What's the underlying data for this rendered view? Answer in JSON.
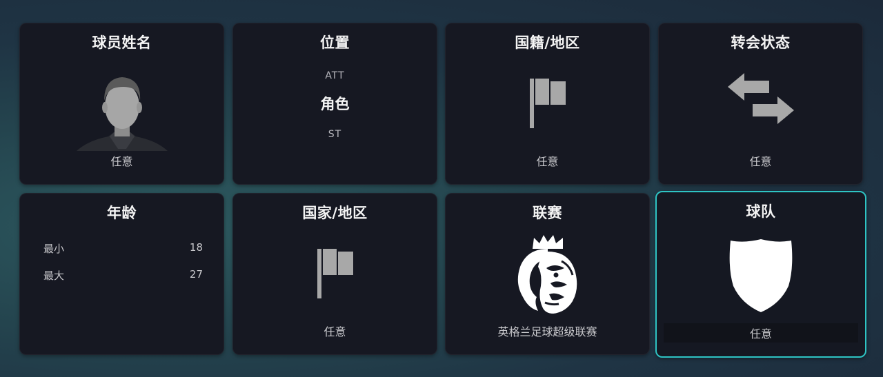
{
  "cards": {
    "player_name": {
      "title": "球员姓名",
      "value": "任意"
    },
    "position": {
      "title": "位置",
      "top": "ATT",
      "role": "角色",
      "bottom": "ST"
    },
    "nationality": {
      "title": "国籍/地区",
      "value": "任意"
    },
    "transfer_status": {
      "title": "转会状态",
      "value": "任意"
    },
    "age": {
      "title": "年龄",
      "min_label": "最小",
      "min_value": "18",
      "max_label": "最大",
      "max_value": "27"
    },
    "country": {
      "title": "国家/地区",
      "value": "任意"
    },
    "league": {
      "title": "联赛",
      "value": "英格兰足球超级联赛"
    },
    "team": {
      "title": "球队",
      "value": "任意"
    }
  },
  "colors": {
    "card_bg": "#161822",
    "selected_border": "#2ec4c4",
    "icon_gray": "#a8a8a8"
  },
  "icons": {
    "player_name": "player-silhouette-icon",
    "nationality": "flag-icon",
    "transfer_status": "transfer-arrows-icon",
    "country": "flag-icon",
    "league": "premier-league-lion-icon",
    "team": "shield-icon"
  }
}
